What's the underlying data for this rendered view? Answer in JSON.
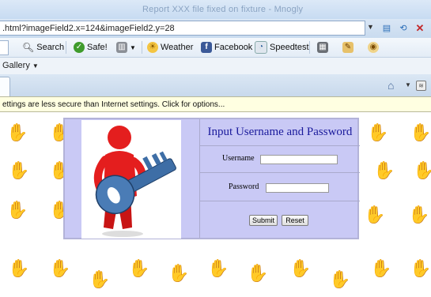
{
  "window": {
    "title": "Report XXX file fixed on fixture - Mnogly"
  },
  "address": {
    "url": ".html?imageField2.x=124&imageField2.y=28"
  },
  "toolbar": {
    "search_label": "Search",
    "safe_label": "Safe!",
    "weather_label": "Weather",
    "facebook_label": "Facebook",
    "speedtest_label": "Speedtest"
  },
  "favorites": {
    "gallery_label": "Gallery"
  },
  "infobar": {
    "text": "ettings are less secure than Internet settings. Click for options..."
  },
  "form": {
    "heading": "Input Username and Password",
    "username_label": "Username",
    "password_label": "Password",
    "username_value": "",
    "password_value": "",
    "submit_label": "Submit",
    "reset_label": "Reset"
  },
  "colors": {
    "panel_bg": "#c9c9f5",
    "heading": "#1a1a9c",
    "infobar_bg": "#ffffe1",
    "figure_red": "#e41e1e",
    "key_blue": "#3e6ea6"
  }
}
